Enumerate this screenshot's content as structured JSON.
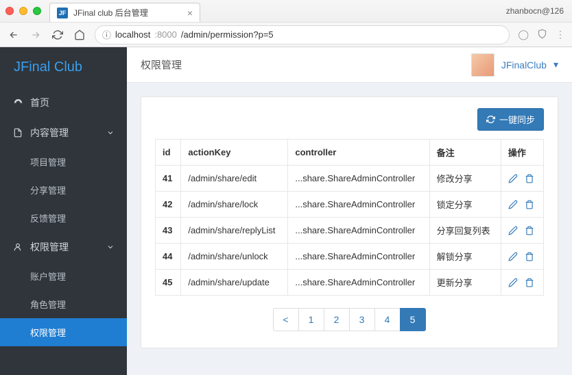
{
  "chrome": {
    "tab_title": "JFinal club 后台管理",
    "favicon_text": "JF",
    "user_label": "zhanbocn@126",
    "url_host": "localhost",
    "url_port": ":8000",
    "url_path": "/admin/permission?p=5"
  },
  "brand": "JFinal Club",
  "sidebar": {
    "home": "首页",
    "content_mgmt": "内容管理",
    "content_children": {
      "project": "项目管理",
      "share": "分享管理",
      "feedback": "反馈管理"
    },
    "perm_mgmt": "权限管理",
    "perm_children": {
      "account": "账户管理",
      "role": "角色管理",
      "permission": "权限管理"
    }
  },
  "topbar": {
    "title": "权限管理",
    "username": "JFinalClub"
  },
  "sync_button": "一键同步",
  "table": {
    "headers": {
      "id": "id",
      "actionKey": "actionKey",
      "controller": "controller",
      "remark": "备注",
      "ops": "操作"
    },
    "rows": [
      {
        "id": "41",
        "actionKey": "/admin/share/edit",
        "controller": "...share.ShareAdminController",
        "remark": "修改分享"
      },
      {
        "id": "42",
        "actionKey": "/admin/share/lock",
        "controller": "...share.ShareAdminController",
        "remark": "锁定分享"
      },
      {
        "id": "43",
        "actionKey": "/admin/share/replyList",
        "controller": "...share.ShareAdminController",
        "remark": "分享回复列表"
      },
      {
        "id": "44",
        "actionKey": "/admin/share/unlock",
        "controller": "...share.ShareAdminController",
        "remark": "解锁分享"
      },
      {
        "id": "45",
        "actionKey": "/admin/share/update",
        "controller": "...share.ShareAdminController",
        "remark": "更新分享"
      }
    ]
  },
  "pagination": {
    "prev": "<",
    "pages": [
      "1",
      "2",
      "3",
      "4",
      "5"
    ],
    "active": "5"
  }
}
